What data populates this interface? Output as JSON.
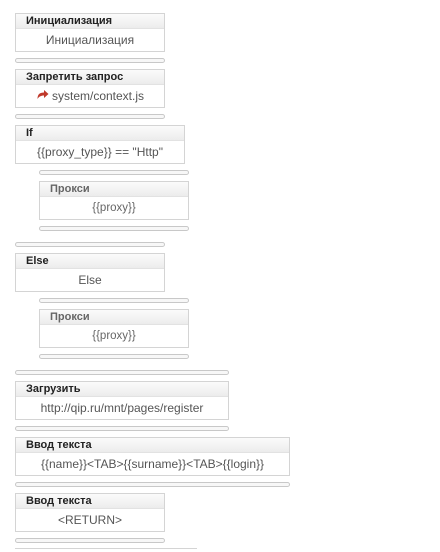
{
  "blocks": [
    {
      "title": "Инициализация",
      "body": "Инициализация"
    },
    {
      "title": "Запретить запрос",
      "body": "system/context.js",
      "icon": "redo-arrow-icon",
      "icon_color": "#c0392b"
    },
    {
      "title": "If",
      "body": "{{proxy_type}} == \"Http\""
    },
    {
      "title": "Прокси",
      "body": "{{proxy}}"
    },
    {
      "title": "Else",
      "body": "Else"
    },
    {
      "title": "Прокси",
      "body": "{{proxy}}"
    },
    {
      "title": "Загрузить",
      "body": "http://qip.ru/mnt/pages/register"
    },
    {
      "title": "Ввод текста",
      "body": "{{name}}<TAB>{{surname}}<TAB>{{login}}"
    },
    {
      "title": "Ввод текста",
      "body": "<RETURN>"
    }
  ]
}
